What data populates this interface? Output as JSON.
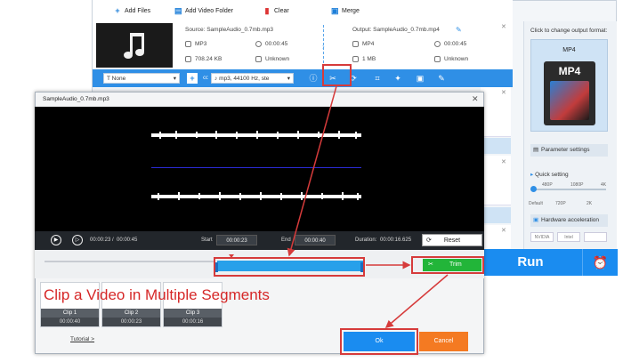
{
  "toolbar": {
    "add_files": "Add Files",
    "add_video_folder": "Add Video Folder",
    "clear": "Clear",
    "merge": "Merge"
  },
  "file": {
    "source": "Source: SampleAudio_0.7mb.mp3",
    "output": "Output: SampleAudio_0.7mb.mp4",
    "src_format": "MP3",
    "src_duration": "00:00:45",
    "src_size": "708.24 KB",
    "src_resolution": "Unknown",
    "out_format": "MP4",
    "out_duration": "00:00:45",
    "out_size": "1 MB",
    "out_resolution": "Unknown"
  },
  "editbar": {
    "subtitle": "None",
    "audio_track": "mp3, 44100 Hz, ste"
  },
  "right_panel": {
    "format_title": "Click to change output format:",
    "format_name": "MP4",
    "format_icon_text": "MP4",
    "parameter_settings": "Parameter settings",
    "quick_setting": "Quick setting",
    "slider_labels_top": [
      "480P",
      "1080P",
      "4K"
    ],
    "slider_labels_bottom": [
      "Default",
      "720P",
      "2K"
    ],
    "hardware_acceleration": "Hardware acceleration",
    "gpu_labels": [
      "NVIDIA",
      "Intel",
      ""
    ],
    "run": "Run"
  },
  "dialog": {
    "title": "SampleAudio_0.7mb.mp3",
    "current_time": "00:00:23",
    "total_time": "00:00:45",
    "start_label": "Start",
    "start_value": "00:00:23",
    "end_label": "End",
    "end_value": "00:00:40",
    "duration_label": "Duration:",
    "duration_value": "00:00:16.625",
    "reset": "Reset",
    "trim": "Trim",
    "caption": "Clip a Video in Multiple Segments",
    "clips": [
      {
        "label": "Clip 1",
        "duration": "00:00:40"
      },
      {
        "label": "Clip 2",
        "duration": "00:00:23"
      },
      {
        "label": "Clip 3",
        "duration": "00:00:16"
      }
    ],
    "tutorial": "Tutorial >",
    "ok": "Ok",
    "cancel": "Cancel"
  },
  "colors": {
    "accent_blue": "#2f8fe6",
    "run_blue": "#1a8cf0",
    "trim_green": "#22b539",
    "cancel_orange": "#f47a22",
    "annotation_red": "#d63b3b"
  },
  "icons": [
    "plus-icon",
    "folder-plus-icon",
    "trash-icon",
    "merge-icon",
    "music-note-icon",
    "clock-icon",
    "file-size-icon",
    "resolution-icon",
    "edit-pencil-icon",
    "scissors-icon",
    "crop-icon",
    "effects-icon",
    "watermark-icon",
    "subtitle-edit-icon",
    "play-icon",
    "step-icon",
    "reset-icon",
    "alarm-clock-icon",
    "close-icon"
  ]
}
